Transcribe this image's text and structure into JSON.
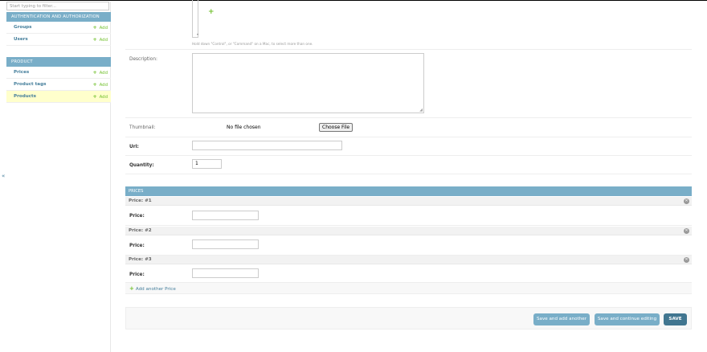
{
  "sidebar": {
    "filter_placeholder": "Start typing to filter...",
    "modules": [
      {
        "title": "Authentication and Authorization",
        "items": [
          {
            "name": "Groups",
            "add": "Add"
          },
          {
            "name": "Users",
            "add": "Add"
          }
        ]
      },
      {
        "title": "Product",
        "items": [
          {
            "name": "Prices",
            "add": "Add"
          },
          {
            "name": "Product tags",
            "add": "Add"
          },
          {
            "name": "Products",
            "add": "Add",
            "selected": true
          }
        ]
      }
    ],
    "collapse_glyph": "«"
  },
  "form": {
    "tags_help": "Hold down \"Control\", or \"Command\" on a Mac, to select more than one.",
    "description_label": "Description:",
    "description_value": "",
    "thumbnail_label": "Thumbnail:",
    "file_button": "Choose File",
    "file_status": "No file chosen",
    "url_label": "Url:",
    "url_value": "",
    "quantity_label": "Quantity:",
    "quantity_value": "1"
  },
  "inline": {
    "title": "Prices",
    "items": [
      {
        "heading": "Price: #1",
        "label": "Price:",
        "value": ""
      },
      {
        "heading": "Price: #2",
        "label": "Price:",
        "value": ""
      },
      {
        "heading": "Price: #3",
        "label": "Price:",
        "value": ""
      }
    ],
    "add_another": "Add another Price"
  },
  "submit": {
    "save_add_another": "Save and add another",
    "save_continue": "Save and continue editing",
    "save": "SAVE"
  },
  "colors": {
    "module_header": "#79aec8",
    "link": "#447e9b",
    "add_green": "#70bf2b",
    "save_button": "#417690",
    "selected_row": "#ffffcc"
  }
}
